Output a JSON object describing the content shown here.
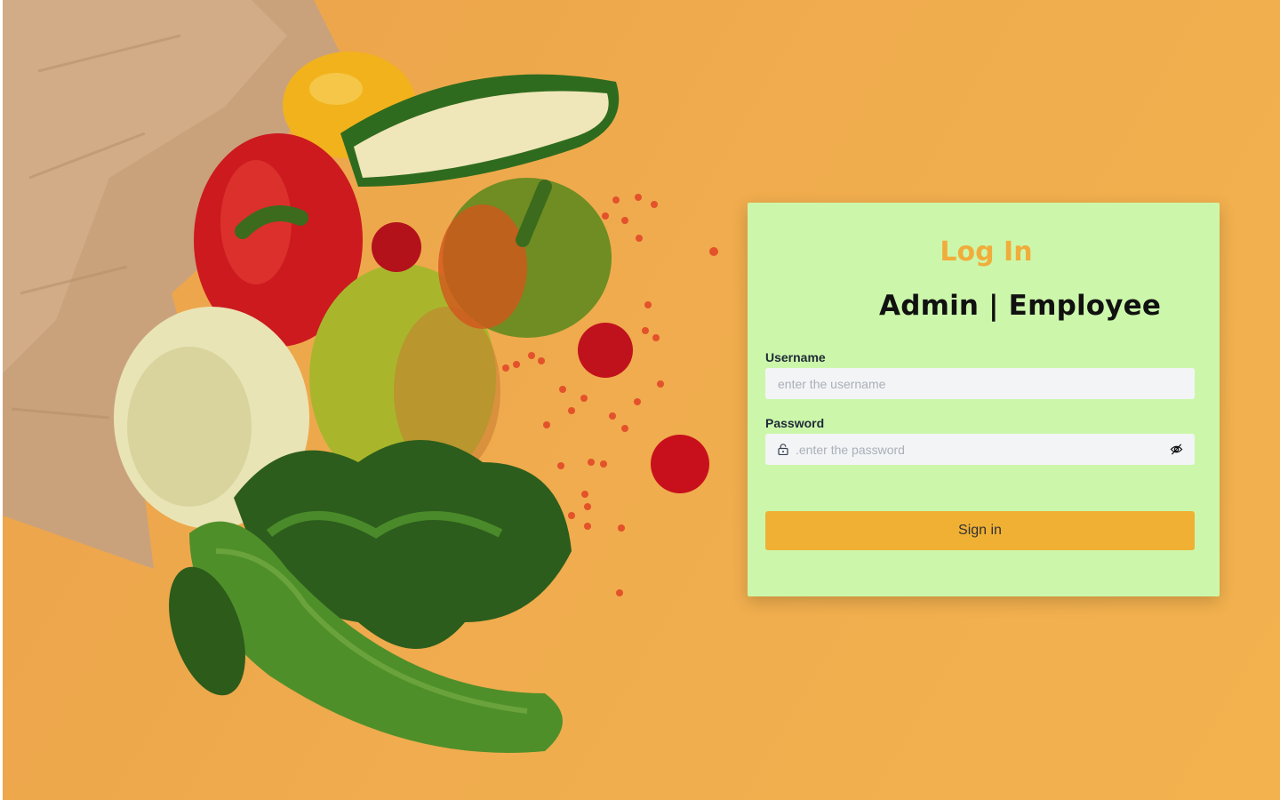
{
  "login_card": {
    "title": "Log In",
    "subtitle": "Admin | Employee",
    "username": {
      "label": "Username",
      "placeholder": "enter the username",
      "value": ""
    },
    "password": {
      "label": "Password",
      "placeholder": ".enter the password",
      "value": "",
      "lock_icon": "lock-icon",
      "visibility_icon": "eye-off-icon"
    },
    "signin_label": "Sign in"
  },
  "colors": {
    "background": "#f0ad4e",
    "card": "#ccf7ab",
    "accent": "#f0b033",
    "title": "#f1ad3b"
  },
  "hero_image": "groceries-paper-bag-vegetables"
}
